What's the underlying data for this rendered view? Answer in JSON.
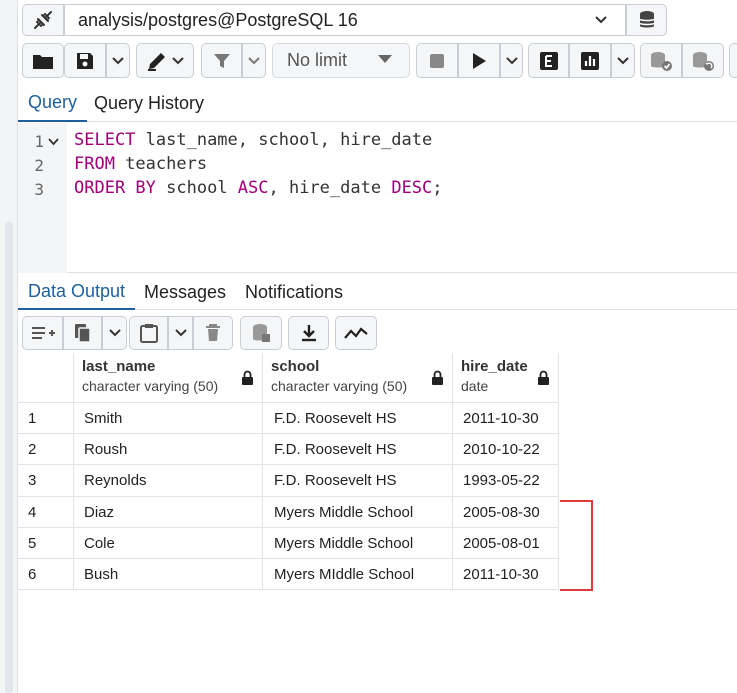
{
  "connection": {
    "label": "analysis/postgres@PostgreSQL 16"
  },
  "toolbar": {
    "limit_label": "No limit"
  },
  "query_tabs": [
    {
      "label": "Query"
    },
    {
      "label": "Query History"
    }
  ],
  "editor": {
    "lines": [
      {
        "num": "1",
        "kw1": "SELECT",
        "rest1": " last_name, school, hire_date"
      },
      {
        "num": "2",
        "kw1": "FROM",
        "rest1": " teachers"
      },
      {
        "num": "3",
        "kw1": "ORDER BY",
        "rest1": " school ",
        "kw2": "ASC",
        "rest2": ", hire_date ",
        "kw3": "DESC",
        "rest3": ";"
      }
    ]
  },
  "output_tabs": [
    {
      "label": "Data Output"
    },
    {
      "label": "Messages"
    },
    {
      "label": "Notifications"
    }
  ],
  "grid": {
    "columns": [
      {
        "name": "last_name",
        "type": "character varying (50)"
      },
      {
        "name": "school",
        "type": "character varying (50)"
      },
      {
        "name": "hire_date",
        "type": "date"
      }
    ],
    "rows": [
      {
        "n": "1",
        "last_name": "Smith",
        "school": "F.D. Roosevelt HS",
        "hire_date": "2011-10-30"
      },
      {
        "n": "2",
        "last_name": "Roush",
        "school": "F.D. Roosevelt HS",
        "hire_date": "2010-10-22"
      },
      {
        "n": "3",
        "last_name": "Reynolds",
        "school": "F.D. Roosevelt HS",
        "hire_date": "1993-05-22"
      },
      {
        "n": "4",
        "last_name": "Diaz",
        "school": "Myers Middle School",
        "hire_date": "2005-08-30"
      },
      {
        "n": "5",
        "last_name": "Cole",
        "school": "Myers Middle School",
        "hire_date": "2005-08-01"
      },
      {
        "n": "6",
        "last_name": "Bush",
        "school": "Myers MIddle School",
        "hire_date": "2011-10-30"
      }
    ]
  },
  "colors": {
    "accent": "#1f5fa0",
    "keyword": "#a1007a",
    "highlight": "#e03b3b"
  }
}
